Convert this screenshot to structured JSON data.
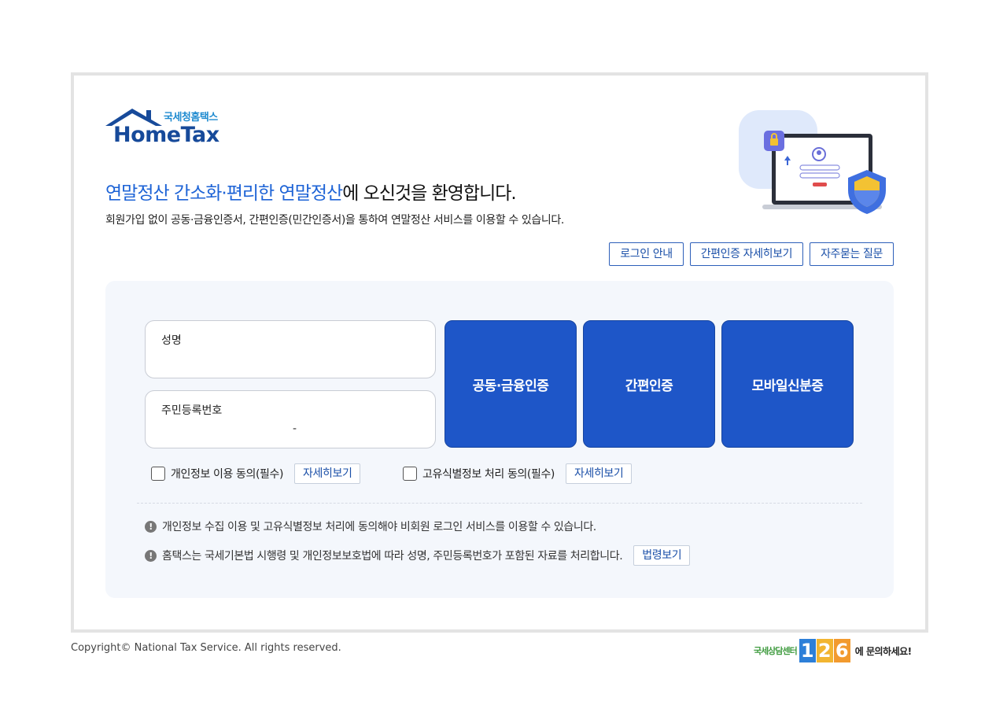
{
  "logo": {
    "subtitle": "국세청홈택스",
    "title": "HomeTax"
  },
  "welcome": {
    "highlight": "연말정산 간소화·편리한 연말정산",
    "rest": "에 오신것을 환영합니다."
  },
  "description": "회원가입 없이 공동·금융인증서, 간편인증(민간인증서)을 통하여 연말정산 서비스를 이용할 수 있습니다.",
  "links": [
    {
      "label": "로그인 안내"
    },
    {
      "label": "간편인증 자세히보기"
    },
    {
      "label": "자주묻는 질문"
    }
  ],
  "form": {
    "name_label": "성명",
    "rrn_label": "주민등록번호",
    "rrn_separator": "-"
  },
  "auth_buttons": [
    {
      "label": "공동·금융인증"
    },
    {
      "label": "간편인증"
    },
    {
      "label": "모바일신분증"
    }
  ],
  "agreements": [
    {
      "label": "개인정보 이용 동의(필수)",
      "detail": "자세히보기",
      "checked": false
    },
    {
      "label": "고유식별정보 처리 동의(필수)",
      "detail": "자세히보기",
      "checked": false
    }
  ],
  "notes": [
    {
      "text": "개인정보 수집 이용 및 고유식별정보 처리에 동의해야 비회원 로그인 서비스를 이용할 수 있습니다."
    },
    {
      "text": "홈택스는 국세기본법 시행령 및 개인정보보호법에 따라 성명, 주민등록번호가 포함된 자료를 처리합니다.",
      "button": "법령보기"
    }
  ],
  "footer": {
    "copyright": "Copyright© National Tax Service. All rights reserved.",
    "callcenter_label": "국세상담센터",
    "callcenter_digits": [
      "1",
      "2",
      "6"
    ],
    "callcenter_suffix": "에 문의하세요!"
  },
  "colors": {
    "primary": "#1e56c8",
    "highlight": "#1d63d6",
    "panel_bg": "#f4f7fc"
  }
}
